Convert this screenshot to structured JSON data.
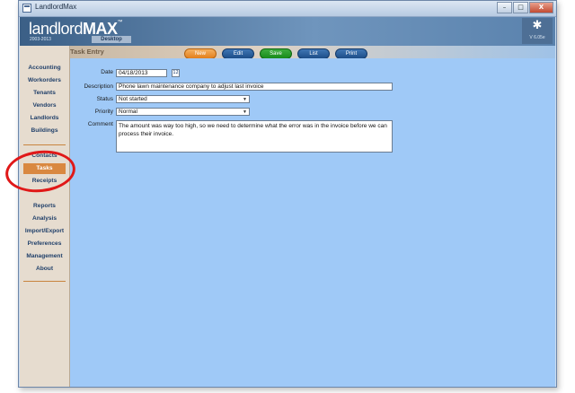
{
  "window": {
    "title": "LandlordMax",
    "minimize": "–",
    "maximize": "□",
    "close": "X"
  },
  "header": {
    "logo_main": "landlord",
    "logo_max": "MAX",
    "logo_tm": "™",
    "years": "2003-2013",
    "edition": "Desktop",
    "star_icon": "✱",
    "version": "V 6.05e"
  },
  "sidebar": {
    "items": [
      {
        "label": "Accounting"
      },
      {
        "label": "Workorders"
      },
      {
        "label": "Tenants"
      },
      {
        "label": "Vendors"
      },
      {
        "label": "Landlords"
      },
      {
        "label": "Buildings"
      },
      {
        "label": "Contacts"
      },
      {
        "label": "Tasks",
        "active": true
      },
      {
        "label": "Receipts"
      },
      {
        "label": "Reports"
      },
      {
        "label": "Analysis"
      },
      {
        "label": "Import/Export"
      },
      {
        "label": "Preferences"
      },
      {
        "label": "Management"
      },
      {
        "label": "About"
      }
    ]
  },
  "section": {
    "title": "Task Entry",
    "buttons": {
      "new": "New",
      "edit": "Edit",
      "save": "Save",
      "list": "List",
      "print": "Print"
    }
  },
  "form": {
    "date_label": "Date",
    "date_value": "04/18/2013",
    "calendar_icon": "12",
    "description_label": "Description",
    "description_value": "Phone lawn maintenance company to adjust last invoice",
    "status_label": "Status",
    "status_value": "Not started",
    "priority_label": "Priority",
    "priority_value": "Normal",
    "comment_label": "Comment",
    "comment_value": "The amount was way too high, so we need to determine what the error was in the invoice before we can process their invoice.",
    "dropdown_icon": "▼"
  },
  "colors": {
    "content_bg": "#9fc9f7",
    "sidebar_bg": "#e6dccf",
    "active_tab": "#d98840",
    "annotation": "#e01818"
  }
}
